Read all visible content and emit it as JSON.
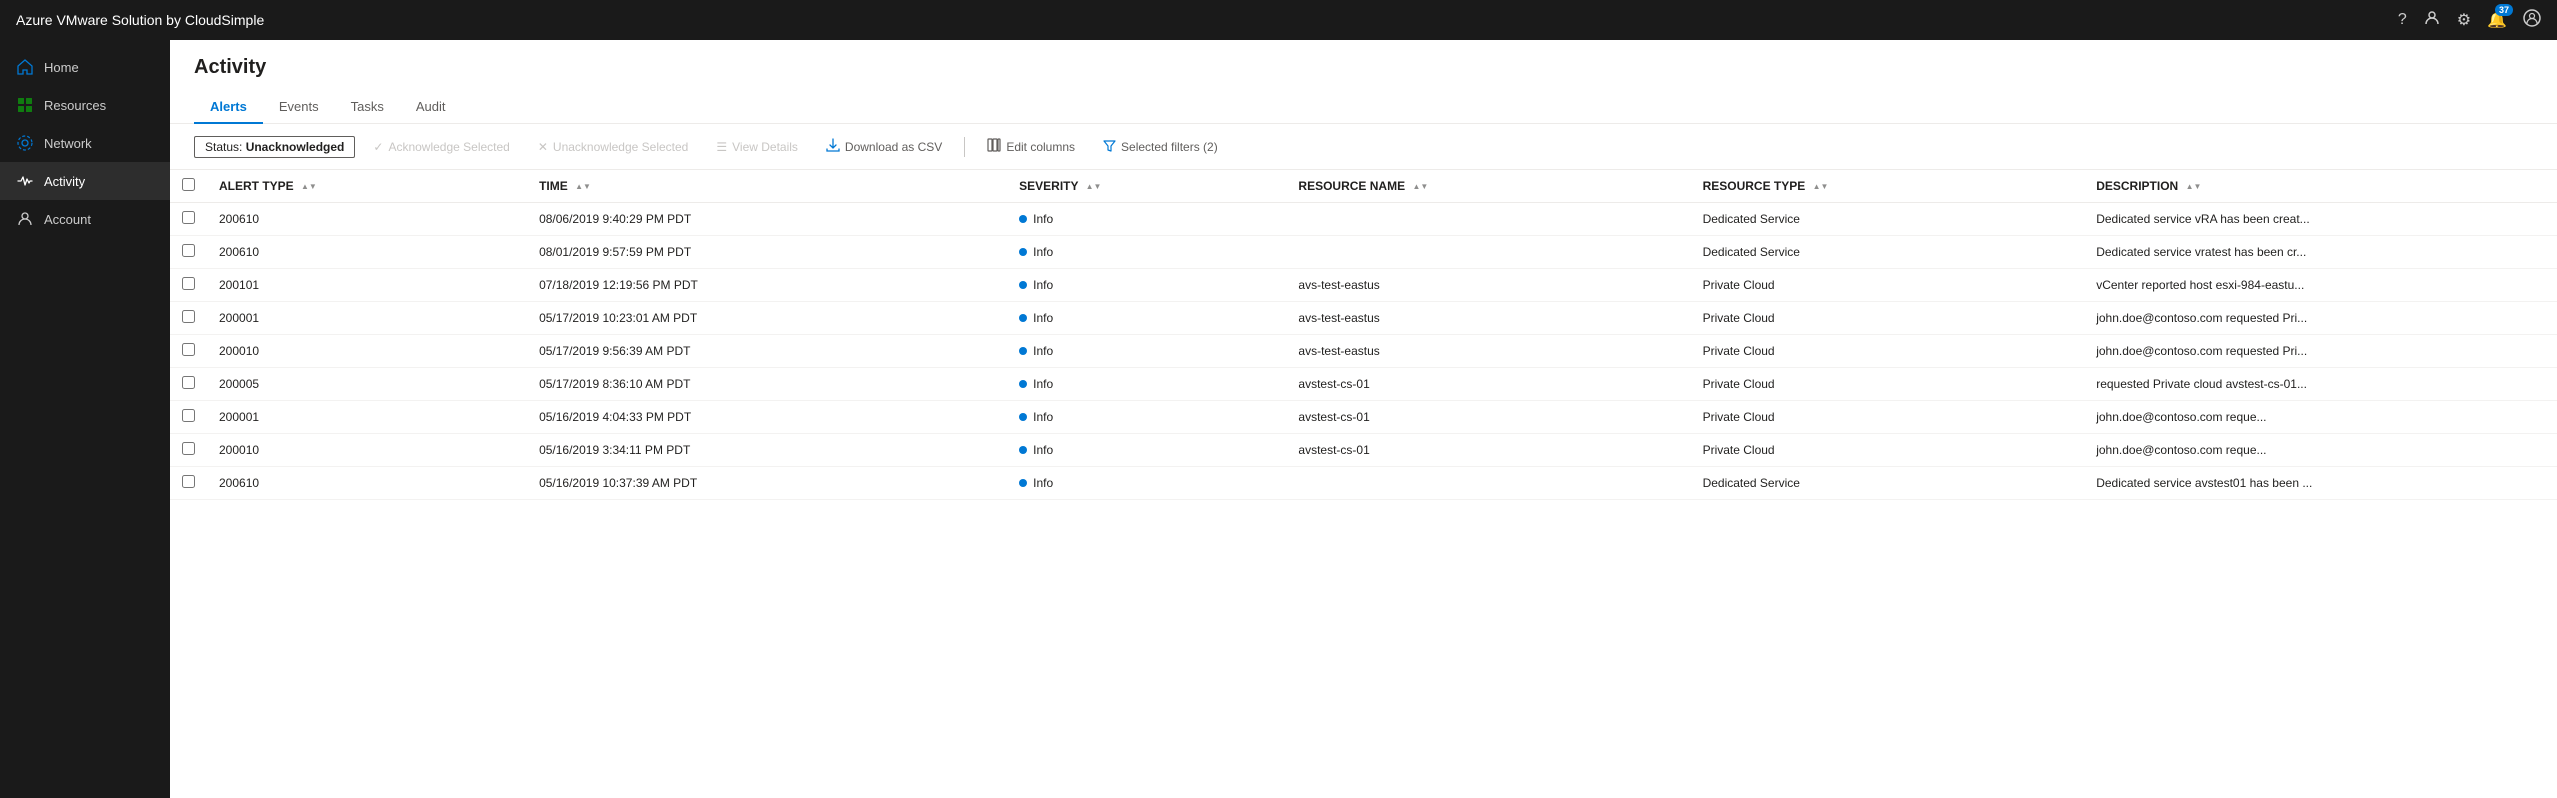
{
  "app": {
    "title": "Azure VMware Solution by CloudSimple"
  },
  "header": {
    "icons": {
      "help": "?",
      "user_manage": "👤",
      "settings": "⚙",
      "notifications": "🔔",
      "notification_count": "37",
      "account": "👤"
    }
  },
  "sidebar": {
    "items": [
      {
        "id": "home",
        "label": "Home",
        "icon": "home"
      },
      {
        "id": "resources",
        "label": "Resources",
        "icon": "grid"
      },
      {
        "id": "network",
        "label": "Network",
        "icon": "network"
      },
      {
        "id": "activity",
        "label": "Activity",
        "icon": "activity",
        "active": true
      },
      {
        "id": "account",
        "label": "Account",
        "icon": "account"
      }
    ]
  },
  "page": {
    "title": "Activity"
  },
  "tabs": [
    {
      "id": "alerts",
      "label": "Alerts",
      "active": true
    },
    {
      "id": "events",
      "label": "Events"
    },
    {
      "id": "tasks",
      "label": "Tasks"
    },
    {
      "id": "audit",
      "label": "Audit"
    }
  ],
  "filter_badge": {
    "prefix": "Status: ",
    "value": "Unacknowledged"
  },
  "toolbar_buttons": [
    {
      "id": "acknowledge",
      "label": "Acknowledge Selected",
      "icon": "✓",
      "disabled": true
    },
    {
      "id": "unacknowledge",
      "label": "Unacknowledge Selected",
      "icon": "✕",
      "disabled": true
    },
    {
      "id": "view_details",
      "label": "View Details",
      "icon": "☰",
      "disabled": true
    },
    {
      "id": "download_csv",
      "label": "Download as CSV",
      "icon": "⬇"
    },
    {
      "id": "edit_columns",
      "label": "Edit columns",
      "icon": "▦"
    },
    {
      "id": "selected_filters",
      "label": "Selected filters (2)",
      "icon": "▼"
    }
  ],
  "table": {
    "columns": [
      {
        "id": "checkbox",
        "label": ""
      },
      {
        "id": "alert_type",
        "label": "ALERT TYPE"
      },
      {
        "id": "time",
        "label": "TIME"
      },
      {
        "id": "severity",
        "label": "SEVERITY"
      },
      {
        "id": "resource_name",
        "label": "RESOURCE NAME"
      },
      {
        "id": "resource_type",
        "label": "RESOURCE TYPE"
      },
      {
        "id": "description",
        "label": "DESCRIPTION"
      }
    ],
    "rows": [
      {
        "alert_type": "200610",
        "time": "08/06/2019 9:40:29 PM PDT",
        "severity": "Info",
        "severity_level": "info",
        "resource_name": "",
        "resource_type": "Dedicated Service",
        "description": "Dedicated service vRA has been creat..."
      },
      {
        "alert_type": "200610",
        "time": "08/01/2019 9:57:59 PM PDT",
        "severity": "Info",
        "severity_level": "info",
        "resource_name": "",
        "resource_type": "Dedicated Service",
        "description": "Dedicated service vratest has been cr..."
      },
      {
        "alert_type": "200101",
        "time": "07/18/2019 12:19:56 PM PDT",
        "severity": "Info",
        "severity_level": "info",
        "resource_name": "avs-test-eastus",
        "resource_type": "Private Cloud",
        "description": "vCenter reported host esxi-984-eastu..."
      },
      {
        "alert_type": "200001",
        "time": "05/17/2019 10:23:01 AM PDT",
        "severity": "Info",
        "severity_level": "info",
        "resource_name": "avs-test-eastus",
        "resource_type": "Private Cloud",
        "description": "john.doe@contoso.com  requested Pri..."
      },
      {
        "alert_type": "200010",
        "time": "05/17/2019 9:56:39 AM PDT",
        "severity": "Info",
        "severity_level": "info",
        "resource_name": "avs-test-eastus",
        "resource_type": "Private Cloud",
        "description": "john.doe@contoso.com  requested Pri..."
      },
      {
        "alert_type": "200005",
        "time": "05/17/2019 8:36:10 AM PDT",
        "severity": "Info",
        "severity_level": "info",
        "resource_name": "avstest-cs-01",
        "resource_type": "Private Cloud",
        "description": "requested Private cloud avstest-cs-01..."
      },
      {
        "alert_type": "200001",
        "time": "05/16/2019 4:04:33 PM PDT",
        "severity": "Info",
        "severity_level": "info",
        "resource_name": "avstest-cs-01",
        "resource_type": "Private Cloud",
        "description": "john.doe@contoso.com    reque..."
      },
      {
        "alert_type": "200010",
        "time": "05/16/2019 3:34:11 PM PDT",
        "severity": "Info",
        "severity_level": "info",
        "resource_name": "avstest-cs-01",
        "resource_type": "Private Cloud",
        "description": "john.doe@contoso.com    reque..."
      },
      {
        "alert_type": "200610",
        "time": "05/16/2019 10:37:39 AM PDT",
        "severity": "Info",
        "severity_level": "info",
        "resource_name": "",
        "resource_type": "Dedicated Service",
        "description": "Dedicated service avstest01 has been ..."
      }
    ]
  }
}
